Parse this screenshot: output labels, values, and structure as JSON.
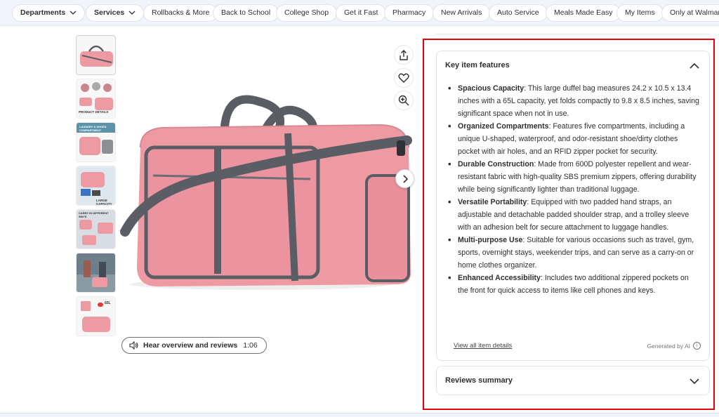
{
  "nav": {
    "items": [
      {
        "label": "Departments",
        "dropdown": true
      },
      {
        "label": "Services",
        "dropdown": true
      },
      {
        "label": "Rollbacks & More"
      },
      {
        "label": "Back to School"
      },
      {
        "label": "College Shop"
      },
      {
        "label": "Get it Fast"
      },
      {
        "label": "Pharmacy"
      },
      {
        "label": "New Arrivals"
      },
      {
        "label": "Auto Service"
      },
      {
        "label": "Meals Made Easy"
      },
      {
        "label": "My Items"
      },
      {
        "label": "Only at Walmart"
      }
    ]
  },
  "product": {
    "color": "#ee9aa2",
    "strap_color": "#5a5d63",
    "thumbnails": [
      {
        "caption": ""
      },
      {
        "caption": "PRODUCT DETAILS"
      },
      {
        "caption": "LAUNDRY & SHOES COMPARTMENT"
      },
      {
        "caption": "LARGE CAPACITY"
      },
      {
        "caption": "CARRY IN DIFFERENT WAYS"
      },
      {
        "caption": ""
      },
      {
        "caption": "65L"
      }
    ],
    "audio": {
      "label": "Hear overview and reviews",
      "duration": "1:06"
    }
  },
  "features_card": {
    "title": "Key item features",
    "items": [
      {
        "name": "Spacious Capacity",
        "text": ": This large duffel bag measures 24.2 x 10.5 x 13.4 inches with a 65L capacity, yet folds compactly to 9.8 x 8.5 inches, saving significant space when not in use."
      },
      {
        "name": "Organized Compartments",
        "text": ": Features five compartments, including a unique U-shaped, waterproof, and odor-resistant shoe/dirty clothes pocket with air holes, and an RFID zipper pocket for security."
      },
      {
        "name": "Durable Construction",
        "text": ": Made from 600D polyester repellent and wear-resistant fabric with high-quality SBS premium zippers, offering durability while being significantly lighter than traditional luggage."
      },
      {
        "name": "Versatile Portability",
        "text": ": Equipped with two padded hand straps, an adjustable and detachable padded shoulder strap, and a trolley sleeve with an adhesion belt for secure attachment to luggage handles."
      },
      {
        "name": "Multi-purpose Use",
        "text": ": Suitable for various occasions such as travel, gym, sports, overnight stays, weekender trips, and can serve as a carry-on or home clothes organizer."
      },
      {
        "name": "Enhanced Accessibility",
        "text": ": Includes two additional zippered pockets on the front for quick access to items like cell phones and keys."
      }
    ],
    "view_all": "View all item details",
    "generated": "Generated by AI",
    "info_glyph": "i"
  },
  "reviews_card": {
    "title": "Reviews summary"
  },
  "colors": {
    "highlight": "#e8000b",
    "nav_bg": "#f1f4fa"
  }
}
